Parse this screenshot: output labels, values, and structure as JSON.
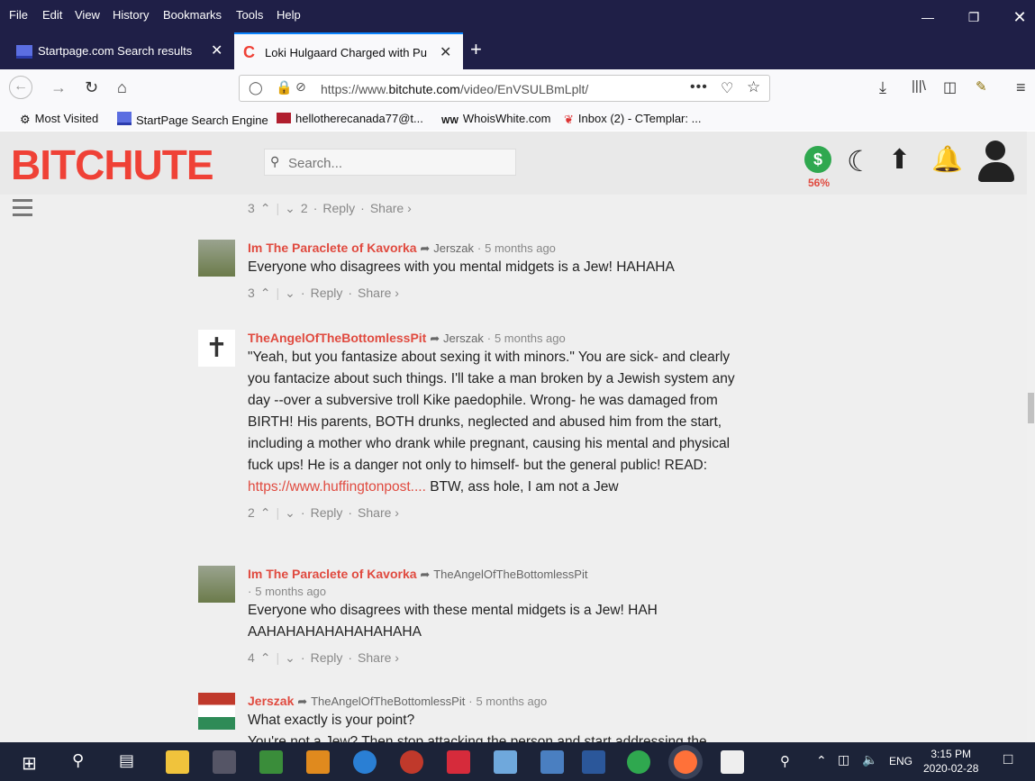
{
  "menu": [
    "File",
    "Edit",
    "View",
    "History",
    "Bookmarks",
    "Tools",
    "Help"
  ],
  "tabs": [
    {
      "label": "Startpage.com Search results"
    },
    {
      "label": "Loki Hulgaard Charged with Pu"
    }
  ],
  "url": {
    "prefix": "https://www.",
    "domain": "bitchute.com",
    "path": "/video/EnVSULBmLplt/"
  },
  "bookmarks": [
    "Most Visited",
    "StartPage Search Engine",
    "hellotherecanada77@t...",
    "WhoisWhite.com",
    "Inbox (2) - CTemplar: ..."
  ],
  "site": {
    "logo": "BITCHUTE",
    "search_placeholder": "Search...",
    "wallet_percent": "56%"
  },
  "top_votes": {
    "up": "3",
    "down": "2",
    "reply": "Reply",
    "share": "Share ›"
  },
  "comments": [
    {
      "user": "Im The Paraclete of Kavorka",
      "reply_to": "Jerszak",
      "time": "5 months ago",
      "text": "Everyone who disagrees with you mental midgets is a Jew! HAHAHA",
      "up": "3",
      "down": "",
      "reply": "Reply",
      "share": "Share ›"
    },
    {
      "user": "TheAngelOfTheBottomlessPit",
      "reply_to": "Jerszak",
      "time": "5 months ago",
      "text_before": "\"Yeah, but you fantasize about sexing it with minors.\" You are sick- and clearly you fantacize about such things. I'll take a man broken by a Jewish system any day --over a subversive troll Kike paedophile. Wrong- he was damaged from BIRTH! His parents, BOTH drunks, neglected and abused him from the start, including a mother who drank while pregnant, causing his mental and physical fuck ups! He is a danger not only to himself- but the general public! READ: ",
      "link": "https://www.huffingtonpost....",
      "text_after": " BTW, ass hole, I am not a Jew",
      "up": "2",
      "down": "",
      "reply": "Reply",
      "share": "Share ›"
    },
    {
      "user": "Im The Paraclete of Kavorka",
      "reply_to": "TheAngelOfTheBottomlessPit",
      "time": "5 months ago",
      "text": "Everyone who disagrees with these mental midgets is a Jew! HAHAAHAHAHAHAHAHAHAHA",
      "up": "4",
      "down": "",
      "reply": "Reply",
      "share": "Share ›"
    },
    {
      "user": "Jerszak",
      "reply_to": "TheAngelOfTheBottomlessPit",
      "time": "5 months ago",
      "text": "What exactly is your point?",
      "text2": "You're not a Jew? Then stop attacking the person and start addressing the"
    }
  ],
  "taskbar": {
    "time": "3:15 PM",
    "date": "2020-02-28",
    "lang": "ENG"
  },
  "colors": {
    "accent": "#e04a3f",
    "titlebar": "#1f1f47",
    "taskbar": "#1c2338",
    "wallet": "#2fa84f"
  }
}
